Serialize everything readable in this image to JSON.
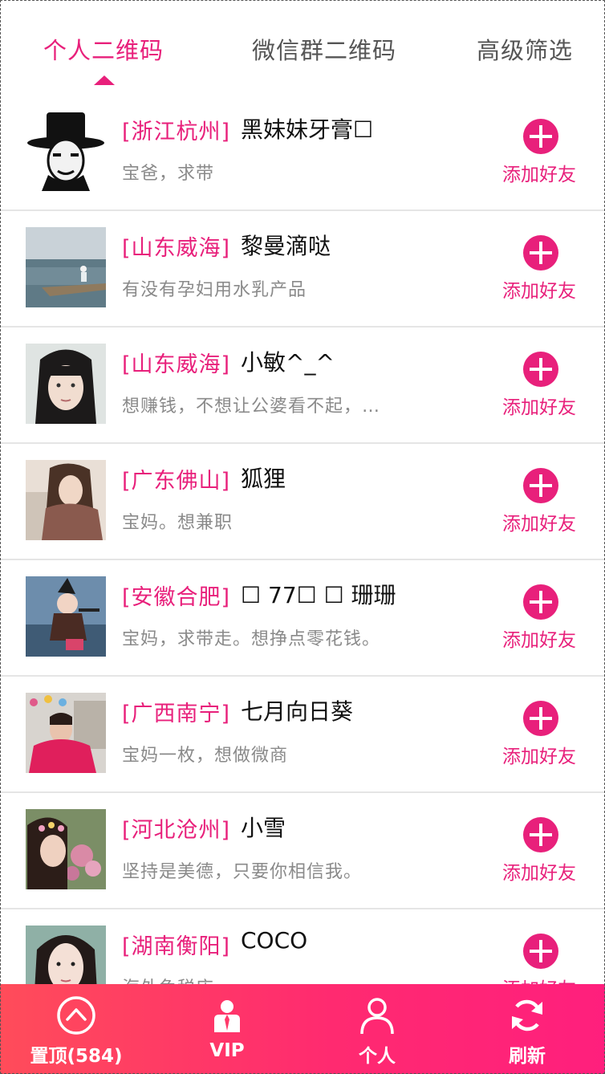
{
  "tabs": [
    {
      "label": "个人二维码",
      "active": true
    },
    {
      "label": "微信群二维码",
      "active": false
    },
    {
      "label": "高级筛选",
      "active": false
    }
  ],
  "accent_color": "#e8207b",
  "list": [
    {
      "location": "[浙江杭州]",
      "name": "黑妹妹牙膏☐",
      "desc": "宝爸，求带",
      "action": "添加好友"
    },
    {
      "location": "[山东威海]",
      "name": "黎曼滴哒",
      "desc": "有没有孕妇用水乳产品",
      "action": "添加好友"
    },
    {
      "location": "[山东威海]",
      "name": "小敏^_^",
      "desc": "想赚钱，不想让公婆看不起，…",
      "action": "添加好友"
    },
    {
      "location": "[广东佛山]",
      "name": "狐狸",
      "desc": "宝妈。想兼职",
      "action": "添加好友"
    },
    {
      "location": "[安徽合肥]",
      "name": "☐ 77☐ ☐ 珊珊",
      "desc": "宝妈，求带走。想挣点零花钱。",
      "action": "添加好友"
    },
    {
      "location": "[广西南宁]",
      "name": "七月向日葵",
      "desc": "宝妈一枚，想做微商",
      "action": "添加好友"
    },
    {
      "location": "[河北沧州]",
      "name": "小雪",
      "desc": "坚持是美德，只要你相信我。",
      "action": "添加好友"
    },
    {
      "location": "[湖南衡阳]",
      "name": "COCO",
      "desc": "海外免税店",
      "action": "添加好友"
    }
  ],
  "bottom_nav": [
    {
      "label": "置顶(584)",
      "icon": "chevron-up-circle-icon"
    },
    {
      "label": "VIP",
      "icon": "vip-person-icon"
    },
    {
      "label": "个人",
      "icon": "person-icon"
    },
    {
      "label": "刷新",
      "icon": "refresh-icon"
    }
  ]
}
